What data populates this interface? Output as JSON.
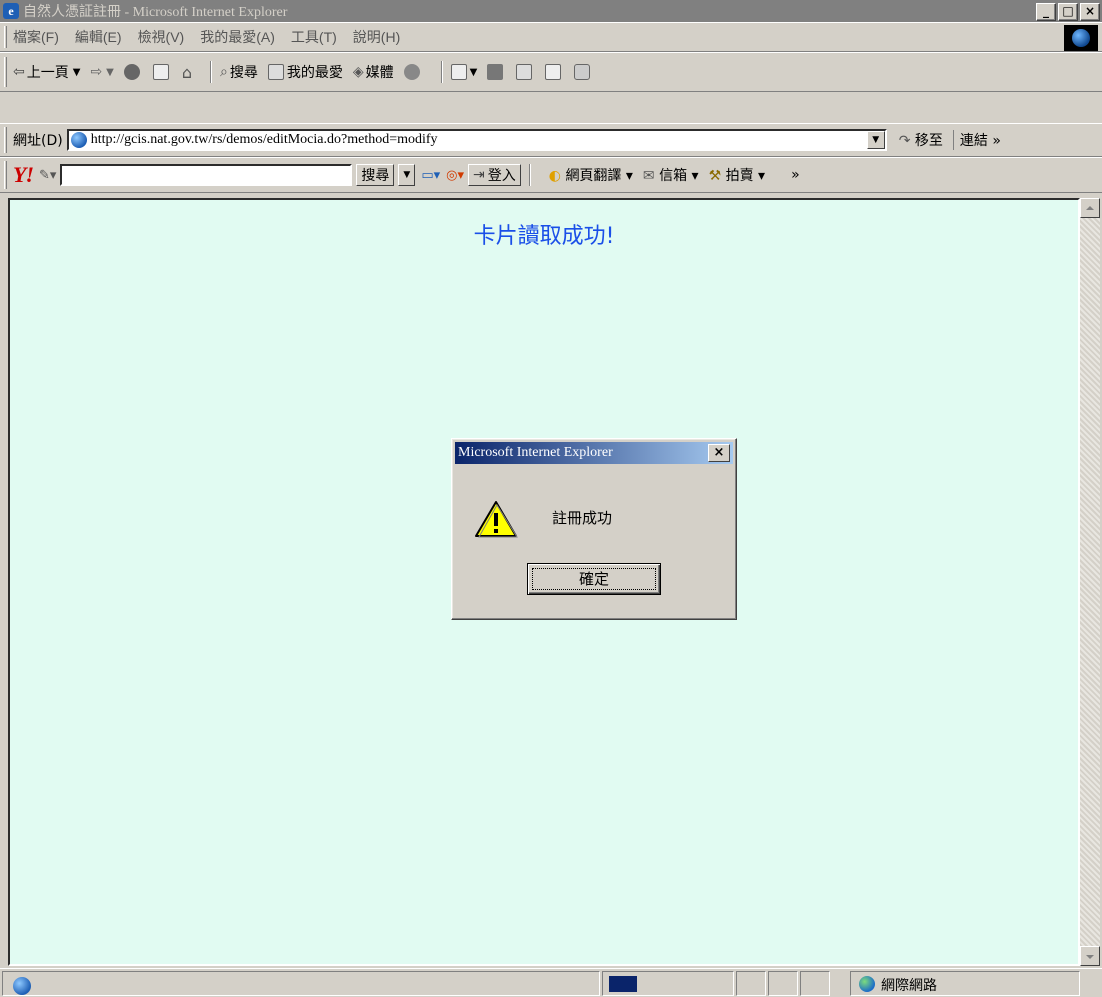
{
  "window": {
    "title": "自然人憑証註冊 - Microsoft Internet Explorer",
    "minimize_label": "_",
    "maximize_label": "□",
    "close_label": "×"
  },
  "menu": {
    "items": [
      {
        "label": "檔案(F)"
      },
      {
        "label": "編輯(E)"
      },
      {
        "label": "檢視(V)"
      },
      {
        "label": "我的最愛(A)"
      },
      {
        "label": "工具(T)"
      },
      {
        "label": "說明(H)"
      }
    ]
  },
  "toolbar": {
    "back_label": "上一頁",
    "search_label": "搜尋",
    "favorites_label": "我的最愛",
    "media_label": "媒體"
  },
  "address": {
    "label": "網址(D)",
    "url": "http://gcis.nat.gov.tw/rs/demos/editMocia.do?method=modify",
    "go_label": "移至",
    "links_label": "連結 »"
  },
  "yahoo_bar": {
    "logo": "Y!",
    "search_value": "",
    "search_button": "搜尋",
    "login_label": "登入",
    "translate_label": "網頁翻譯",
    "mail_label": "信箱",
    "auction_label": "拍賣",
    "more_label": "»"
  },
  "page": {
    "message": "卡片讀取成功!"
  },
  "dialog": {
    "title": "Microsoft Internet Explorer",
    "close_label": "×",
    "message": "註冊成功",
    "ok_label": "確定",
    "icon": "warning-icon"
  },
  "status": {
    "zone_label": "網際網路"
  },
  "colors": {
    "page_background": "#e1fbf2",
    "message_text": "#1a4fe8",
    "dialog_title_start": "#0a246a",
    "dialog_title_end": "#a6caf0",
    "inactive_titlebar": "#808080"
  }
}
